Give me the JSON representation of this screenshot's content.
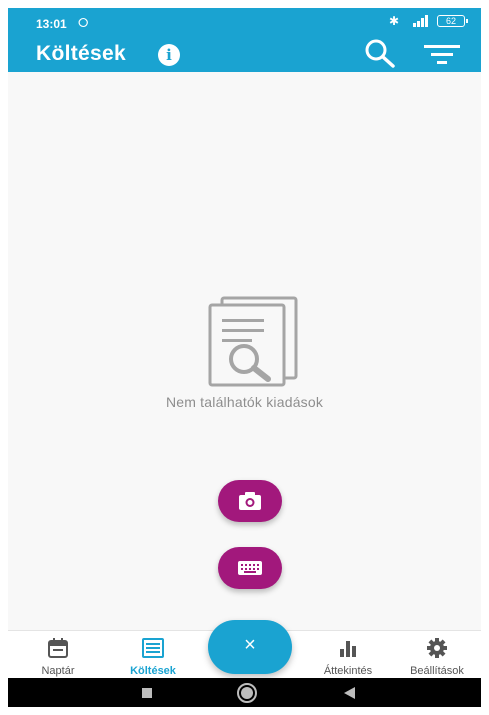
{
  "status_bar": {
    "time": "13:01",
    "sync_glyph": "⭘",
    "battery": "62"
  },
  "app_bar": {
    "title": "Költések",
    "info_glyph": "i"
  },
  "empty_state": {
    "message": "Nem találhatók kiadások"
  },
  "fabs": {
    "camera_icon": "camera-icon",
    "keyboard_icon": "keyboard-icon",
    "main_glyph": "×"
  },
  "bottom_nav": {
    "items": [
      {
        "label": "Naptár",
        "icon": "calendar-icon",
        "active": false
      },
      {
        "label": "Költések",
        "icon": "list-icon",
        "active": true
      },
      {
        "label": "Áttekintés",
        "icon": "bar-chart-icon",
        "active": false
      },
      {
        "label": "Beállítások",
        "icon": "gear-icon",
        "active": false
      }
    ]
  },
  "colors": {
    "primary": "#1aa3d1",
    "accent": "#a2187c",
    "background": "#f8f8f8"
  }
}
